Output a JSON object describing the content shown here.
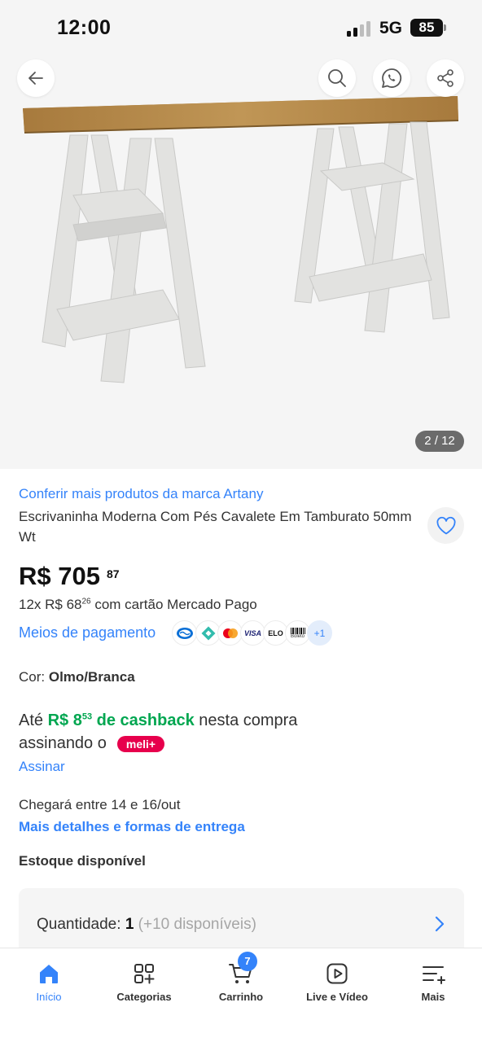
{
  "status_bar": {
    "time": "12:00",
    "network": "5G",
    "battery": "85"
  },
  "gallery": {
    "counter": "2 / 12",
    "icons": [
      "back-arrow-icon",
      "search-icon",
      "whatsapp-icon",
      "share-icon"
    ]
  },
  "product": {
    "brand_link": "Conferir mais produtos da marca Artany",
    "title": "Escrivaninha Moderna Com Pés Cavalete Em Tamburato 50mm Wt",
    "price_main": "R$ 705",
    "price_cents": "87",
    "installments_prefix": "12x R$ 68",
    "installments_cents": "26",
    "installments_suffix": " com cartão Mercado Pago",
    "payment_link": "Meios de pagamento",
    "payment_more": "+1",
    "payment_elo": "ELO",
    "payment_visa": "VISA",
    "payment_boleto": "Boleto",
    "color_label": "Cor: ",
    "color_value": "Olmo/Branca",
    "cashback_prefix": "Até ",
    "cashback_amount": "R$ 8",
    "cashback_cents": "53",
    "cashback_label": " de cashback",
    "cashback_suffix": " nesta compra",
    "cashback_line2": "assinando o",
    "meli_badge": "meli+",
    "subscribe_link": "Assinar",
    "delivery_text": "Chegará entre 14 e 16/out",
    "delivery_link": "Mais detalhes e formas de entrega",
    "stock": "Estoque disponível",
    "quantity_label": "Quantidade: ",
    "quantity_value": "1",
    "quantity_available": "(+10 disponíveis)"
  },
  "bottom_nav": {
    "items": [
      {
        "label": "Início",
        "icon": "home-icon",
        "active": true
      },
      {
        "label": "Categorias",
        "icon": "categories-icon"
      },
      {
        "label": "Carrinho",
        "icon": "cart-icon"
      },
      {
        "label": "Live e Vídeo",
        "icon": "play-icon"
      },
      {
        "label": "Mais",
        "icon": "menu-plus-icon"
      }
    ],
    "cart_count": "7"
  },
  "colors": {
    "accent": "#3483fa",
    "cashback_green": "#00a650",
    "meli_pink": "#e7004c"
  }
}
